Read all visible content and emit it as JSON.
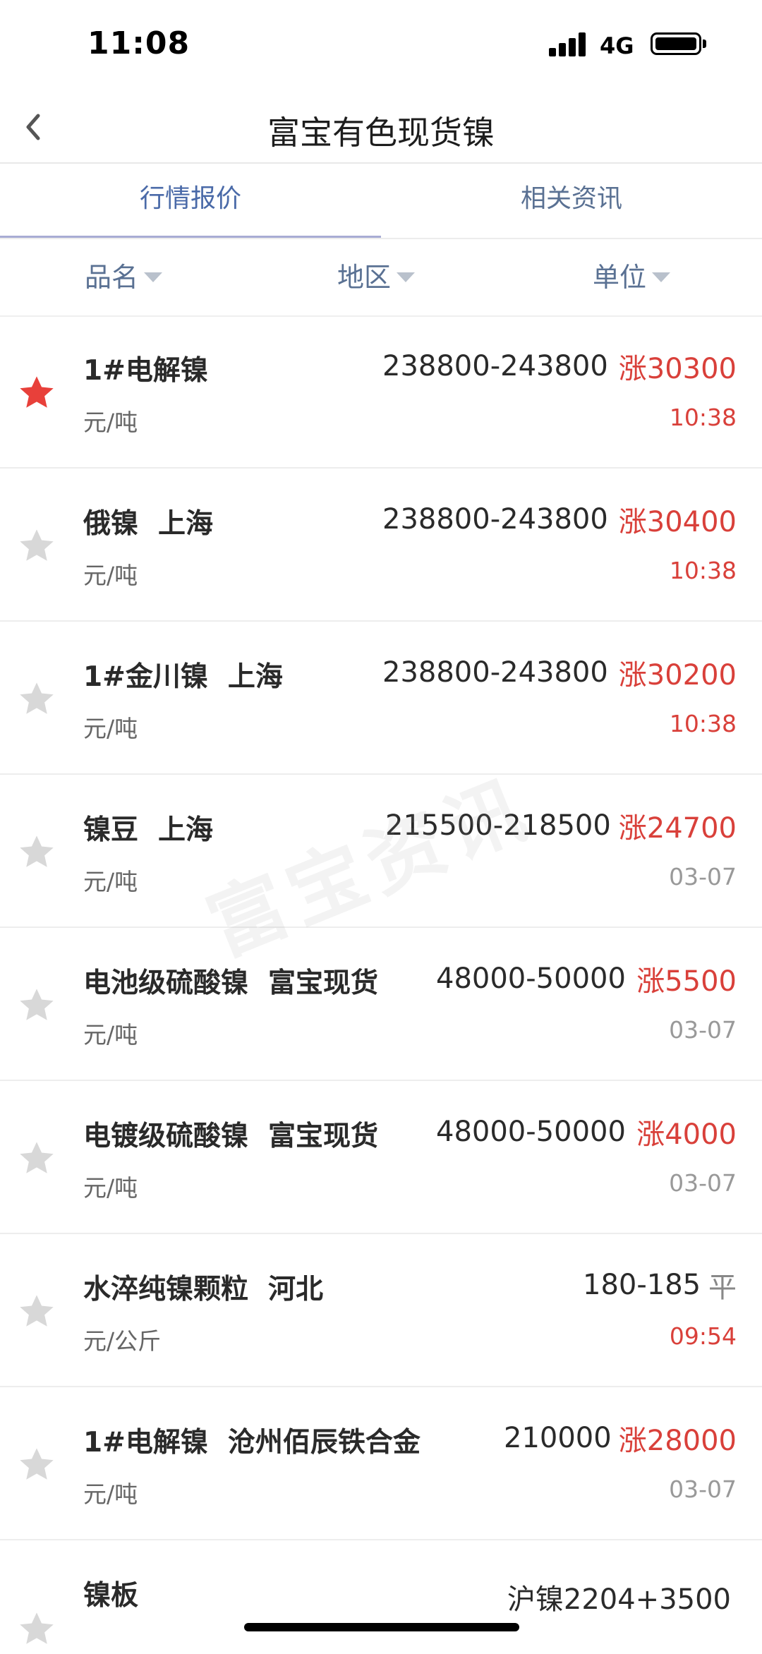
{
  "status": {
    "time": "11:08",
    "network": "4G"
  },
  "nav": {
    "title": "富宝有色现货镍"
  },
  "tabs": [
    {
      "label": "行情报价",
      "active": true
    },
    {
      "label": "相关资讯",
      "active": false
    }
  ],
  "filters": [
    {
      "label": "品名"
    },
    {
      "label": "地区"
    },
    {
      "label": "单位"
    }
  ],
  "colors": {
    "accent": "#4a6aa8",
    "up": "#d9403a",
    "star_active": "#e8403a",
    "star_inactive": "#d8d8d8"
  },
  "items": [
    {
      "name": "1#电解镍",
      "region": "",
      "unit": "元/吨",
      "price": "238800-243800",
      "change": "涨30300",
      "time": "10:38",
      "time_color": "red",
      "starred": true
    },
    {
      "name": "俄镍",
      "region": "上海",
      "unit": "元/吨",
      "price": "238800-243800",
      "change": "涨30400",
      "time": "10:38",
      "time_color": "red",
      "starred": false
    },
    {
      "name": "1#金川镍",
      "region": "上海",
      "unit": "元/吨",
      "price": "238800-243800",
      "change": "涨30200",
      "time": "10:38",
      "time_color": "red",
      "starred": false
    },
    {
      "name": "镍豆",
      "region": "上海",
      "unit": "元/吨",
      "price": "215500-218500",
      "change": "涨24700",
      "time": "03-07",
      "time_color": "gray",
      "starred": false
    },
    {
      "name": "电池级硫酸镍",
      "region": "富宝现货",
      "unit": "元/吨",
      "price": "48000-50000",
      "change": "涨5500",
      "time": "03-07",
      "time_color": "gray",
      "starred": false
    },
    {
      "name": "电镀级硫酸镍",
      "region": "富宝现货",
      "unit": "元/吨",
      "price": "48000-50000",
      "change": "涨4000",
      "time": "03-07",
      "time_color": "gray",
      "starred": false
    },
    {
      "name": "水淬纯镍颗粒",
      "region": "河北",
      "unit": "元/公斤",
      "price": "180-185",
      "change": "平",
      "time": "09:54",
      "time_color": "red",
      "starred": false
    },
    {
      "name": "1#电解镍",
      "region": "沧州佰辰铁合金",
      "unit": "元/吨",
      "price": "210000",
      "change": "涨28000",
      "time": "03-07",
      "time_color": "gray",
      "starred": false
    }
  ],
  "last_item": {
    "name": "镍板",
    "price": "沪镍2204+3500"
  },
  "watermark": "富宝资讯"
}
